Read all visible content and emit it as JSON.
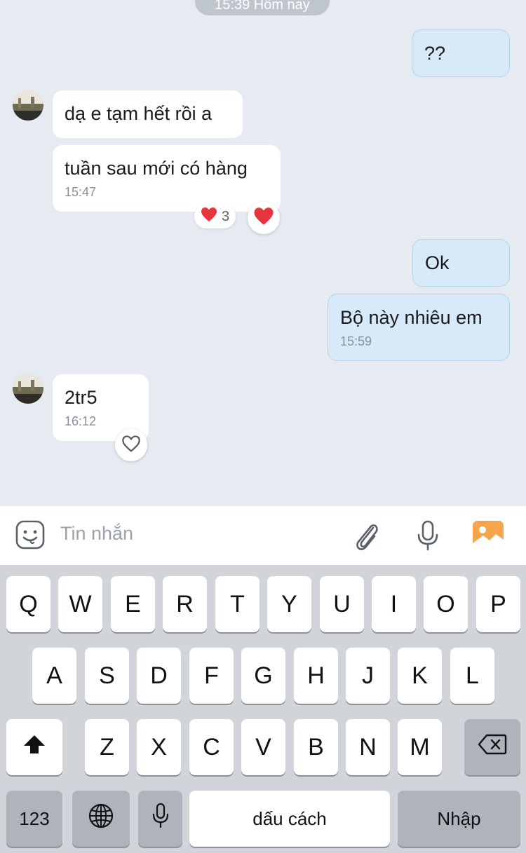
{
  "chat": {
    "date_separator": "15:39 Hôm nay",
    "messages": [
      {
        "side": "out",
        "text": "??"
      },
      {
        "side": "in",
        "text": "dạ e tạm hết rồi a"
      },
      {
        "side": "in",
        "text": "tuần sau mới có hàng",
        "time": "15:47",
        "reaction_count": "3"
      },
      {
        "side": "out",
        "text": "Ok"
      },
      {
        "side": "out",
        "text": "Bộ này nhiêu em",
        "time": "15:59"
      },
      {
        "side": "in",
        "text": "2tr5",
        "time": "16:12"
      }
    ]
  },
  "composer": {
    "placeholder": "Tin nhắn",
    "icons": [
      "sticker-icon",
      "paperclip-icon",
      "microphone-icon",
      "image-icon"
    ]
  },
  "keyboard": {
    "row1": [
      "Q",
      "W",
      "E",
      "R",
      "T",
      "Y",
      "U",
      "I",
      "O",
      "P"
    ],
    "row2": [
      "A",
      "S",
      "D",
      "F",
      "G",
      "H",
      "J",
      "K",
      "L"
    ],
    "row3": [
      "Z",
      "X",
      "C",
      "V",
      "B",
      "N",
      "M"
    ],
    "numbers_label": "123",
    "space_label": "dấu cách",
    "return_label": "Nhập"
  },
  "colors": {
    "chat_background": "#e6eaf1",
    "incoming_bubble": "#ffffff",
    "outgoing_bubble": "#d7eafa",
    "reaction_heart": "#e8343f",
    "image_icon": "#f6a54d"
  }
}
